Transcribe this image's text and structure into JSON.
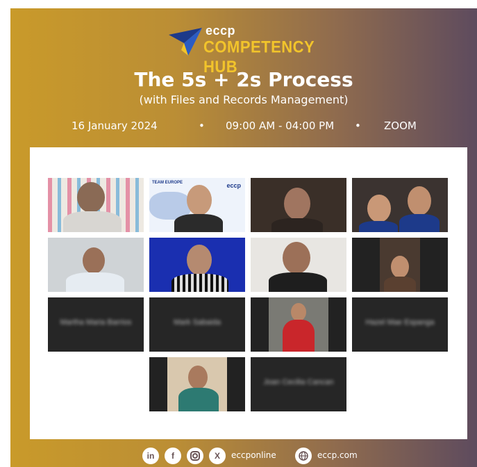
{
  "brand": {
    "logo_top": "eccp",
    "logo_main": "COMPETENCY HUB"
  },
  "event": {
    "title": "The 5s + 2s Process",
    "subtitle": "(with Files and Records Management)",
    "date": "16 January 2024",
    "time": "09:00 AM - 04:00 PM",
    "platform": "ZOOM",
    "separator": "•"
  },
  "tiles": {
    "team_banner": "TEAM EUROPE",
    "team_logo": "eccp",
    "names": [
      "Martha Maria Barrios",
      "Mark Sabaida",
      "Hazel Mae Espanga",
      "Joan Cecilia Cancan"
    ]
  },
  "footer": {
    "social_handle": "eccponline",
    "website": "eccp.com",
    "icons": [
      "linkedin-icon",
      "facebook-icon",
      "instagram-icon",
      "x-icon",
      "globe-icon"
    ]
  },
  "colors": {
    "gradient_left": "#c99a2a",
    "gradient_right": "#5e4b5e",
    "hub_yellow": "#f2c42b",
    "logo_blue": "#1d3a8a"
  }
}
